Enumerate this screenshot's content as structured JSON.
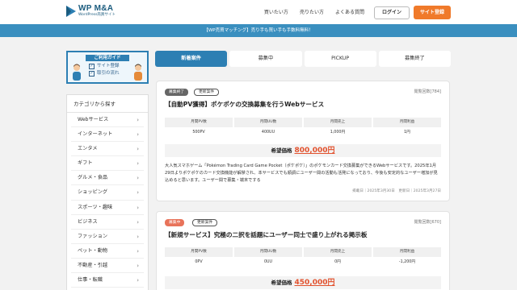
{
  "header": {
    "logo_title": "WP M&A",
    "logo_sub": "WordPress売買サイト",
    "nav": [
      "買いたい方",
      "売りたい方",
      "よくある質問"
    ],
    "login_label": "ログイン",
    "signup_label": "サイト登録"
  },
  "banner": "【WP売買マッチング】売り手も買い手も手数料無料！",
  "guide": {
    "title": "ご利用ガイド",
    "items": [
      "サイト登録",
      "取引の流れ"
    ]
  },
  "categories": {
    "heading": "カテゴリから探す",
    "items": [
      "Webサービス",
      "インターネット",
      "エンタメ",
      "ギフト",
      "グルメ・食品",
      "ショッピング",
      "スポーツ・趣味",
      "ビジネス",
      "ファッション",
      "ペット・動物",
      "不動産・引越",
      "仕事・転職"
    ]
  },
  "tabs": [
    "新着案件",
    "募集中",
    "PICKUP",
    "募集終了"
  ],
  "cards": [
    {
      "status": "募集終了",
      "status_color": "#666666",
      "update_badge": "更新案件",
      "views": "閲覧回数[784]",
      "title": "【自動PV獲得】ポケポケの交換募集を行うWebサービス",
      "metrics": [
        {
          "label": "月間PV数",
          "value": "500PV"
        },
        {
          "label": "月間UU数",
          "value": "400UU"
        },
        {
          "label": "月間売上",
          "value": "1,000円"
        },
        {
          "label": "月間利益",
          "value": "1円"
        }
      ],
      "price_label": "希望価格",
      "price": "800,000円",
      "description": "大人気スマホゲーム「Pokémon Trading Card Game Pocket（ポケポケ）」のポケモンカード交換募集ができるWebサービスです。2025年1月29日よりポケポケのカード交換機能が解禁され、本サービスでも順調にユーザー間の活動も活発になっており、今後も安定的なユーザー増加が見込めると思います。ユーザー間で募集・端末でする",
      "dates": "掲載日｜2025年3月30日　更新日｜2025年3月27日"
    },
    {
      "status": "募集中",
      "status_color": "#e8735a",
      "update_badge": "更新案件",
      "views": "閲覧回数[670]",
      "title": "【新規サービス】究極の二択を話題にユーザー同士で盛り上がれる掲示板",
      "metrics": [
        {
          "label": "月間PV数",
          "value": "0PV"
        },
        {
          "label": "月間UU数",
          "value": "0UU"
        },
        {
          "label": "月間売上",
          "value": "0円"
        },
        {
          "label": "月間利益",
          "value": "-1,200円"
        }
      ],
      "price_label": "希望価格",
      "price": "450,000円"
    }
  ],
  "colors": {
    "brand": "#1a5b7e",
    "accent_blue": "#2d7fb3",
    "banner": "#3a8fbf",
    "signup": "#f07a2a",
    "price": "#e2522e"
  }
}
